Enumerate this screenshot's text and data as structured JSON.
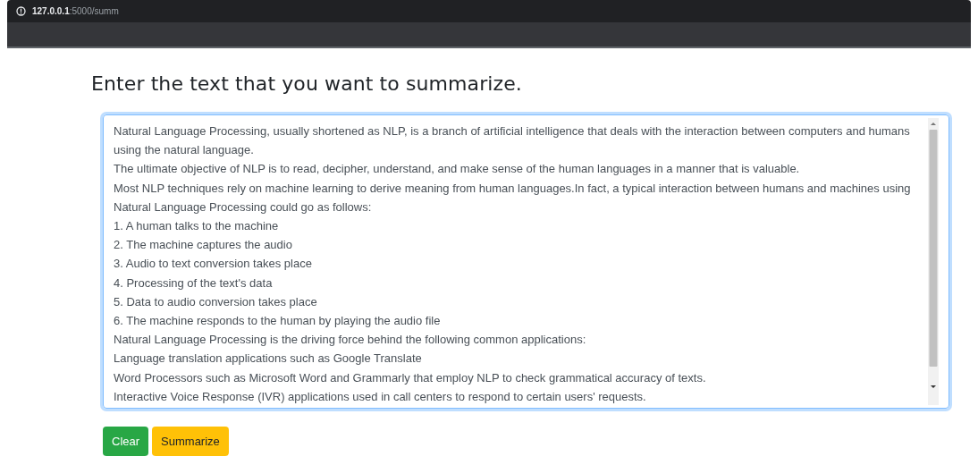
{
  "browser": {
    "url_host": "127.0.0.1",
    "url_path": ":5000/summ"
  },
  "heading": "Enter the text that you want to summarize.",
  "text_area": {
    "value": "Natural Language Processing, usually shortened as NLP, is a branch of artificial intelligence that deals with the interaction between computers and humans using the natural language.\nThe ultimate objective of NLP is to read, decipher, understand, and make sense of the human languages in a manner that is valuable.\nMost NLP techniques rely on machine learning to derive meaning from human languages.In fact, a typical interaction between humans and machines using Natural Language Processing could go as follows:\n1. A human talks to the machine\n2. The machine captures the audio\n3. Audio to text conversion takes place\n4. Processing of the text's data\n5. Data to audio conversion takes place\n6. The machine responds to the human by playing the audio file\nNatural Language Processing is the driving force behind the following common applications:\nLanguage translation applications such as Google Translate\nWord Processors such as Microsoft Word and Grammarly that employ NLP to check grammatical accuracy of texts.\nInteractive Voice Response (IVR) applications used in call centers to respond to certain users' requests.",
    "focused": true
  },
  "buttons": [
    {
      "label": "Clear",
      "kind": "success"
    },
    {
      "label": "Summarize",
      "kind": "warning"
    }
  ]
}
